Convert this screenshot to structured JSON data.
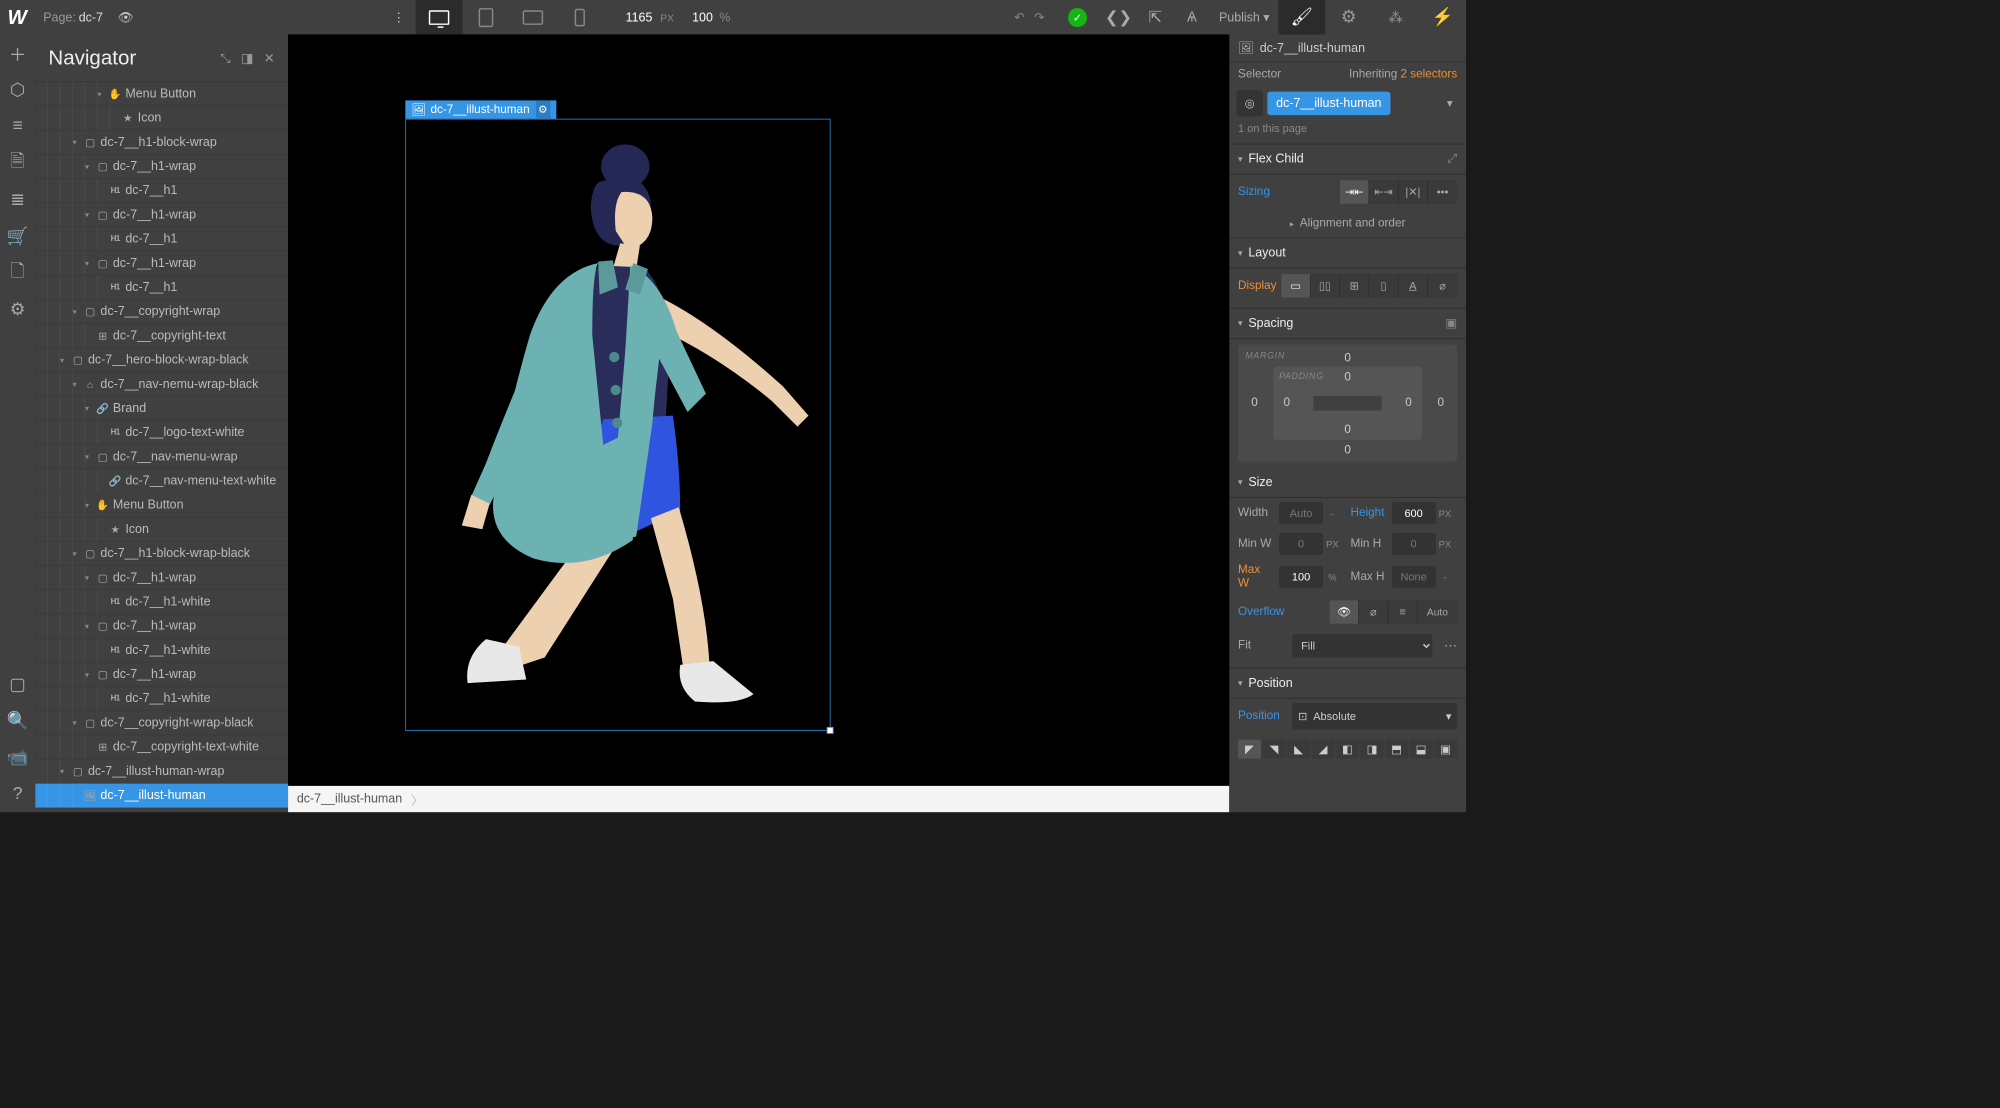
{
  "topbar": {
    "page_label": "Page:",
    "page_name": "dc-7",
    "canvas_width": "1165",
    "canvas_unit": "PX",
    "zoom": "100",
    "zoom_unit": "%",
    "publish": "Publish"
  },
  "navigator": {
    "title": "Navigator",
    "items": [
      {
        "indent": 5,
        "caret": "▾",
        "icon": "✋",
        "label": "Menu Button"
      },
      {
        "indent": 6,
        "caret": "",
        "icon": "★",
        "label": "Icon"
      },
      {
        "indent": 3,
        "caret": "▾",
        "icon": "▢",
        "label": "dc-7__h1-block-wrap"
      },
      {
        "indent": 4,
        "caret": "▾",
        "icon": "▢",
        "label": "dc-7__h1-wrap"
      },
      {
        "indent": 5,
        "caret": "",
        "icon": "H1",
        "label": "dc-7__h1"
      },
      {
        "indent": 4,
        "caret": "▾",
        "icon": "▢",
        "label": "dc-7__h1-wrap"
      },
      {
        "indent": 5,
        "caret": "",
        "icon": "H1",
        "label": "dc-7__h1"
      },
      {
        "indent": 4,
        "caret": "▾",
        "icon": "▢",
        "label": "dc-7__h1-wrap"
      },
      {
        "indent": 5,
        "caret": "",
        "icon": "H1",
        "label": "dc-7__h1"
      },
      {
        "indent": 3,
        "caret": "▾",
        "icon": "▢",
        "label": "dc-7__copyright-wrap"
      },
      {
        "indent": 4,
        "caret": "",
        "icon": "⊞",
        "label": "dc-7__copyright-text"
      },
      {
        "indent": 2,
        "caret": "▾",
        "icon": "▢",
        "label": "dc-7__hero-block-wrap-black"
      },
      {
        "indent": 3,
        "caret": "▾",
        "icon": "⌂",
        "label": "dc-7__nav-nemu-wrap-black"
      },
      {
        "indent": 4,
        "caret": "▾",
        "icon": "🔗",
        "label": "Brand"
      },
      {
        "indent": 5,
        "caret": "",
        "icon": "H1",
        "label": "dc-7__logo-text-white"
      },
      {
        "indent": 4,
        "caret": "▾",
        "icon": "▢",
        "label": "dc-7__nav-menu-wrap"
      },
      {
        "indent": 5,
        "caret": "",
        "icon": "🔗",
        "label": "dc-7__nav-menu-text-white"
      },
      {
        "indent": 4,
        "caret": "▾",
        "icon": "✋",
        "label": "Menu Button"
      },
      {
        "indent": 5,
        "caret": "",
        "icon": "★",
        "label": "Icon"
      },
      {
        "indent": 3,
        "caret": "▾",
        "icon": "▢",
        "label": "dc-7__h1-block-wrap-black"
      },
      {
        "indent": 4,
        "caret": "▾",
        "icon": "▢",
        "label": "dc-7__h1-wrap"
      },
      {
        "indent": 5,
        "caret": "",
        "icon": "H1",
        "label": "dc-7__h1-white"
      },
      {
        "indent": 4,
        "caret": "▾",
        "icon": "▢",
        "label": "dc-7__h1-wrap"
      },
      {
        "indent": 5,
        "caret": "",
        "icon": "H1",
        "label": "dc-7__h1-white"
      },
      {
        "indent": 4,
        "caret": "▾",
        "icon": "▢",
        "label": "dc-7__h1-wrap"
      },
      {
        "indent": 5,
        "caret": "",
        "icon": "H1",
        "label": "dc-7__h1-white"
      },
      {
        "indent": 3,
        "caret": "▾",
        "icon": "▢",
        "label": "dc-7__copyright-wrap-black"
      },
      {
        "indent": 4,
        "caret": "",
        "icon": "⊞",
        "label": "dc-7__copyright-text-white"
      },
      {
        "indent": 2,
        "caret": "▾",
        "icon": "▢",
        "label": "dc-7__illust-human-wrap"
      },
      {
        "indent": 3,
        "caret": "",
        "icon": "🖼",
        "label": "dc-7__illust-human",
        "selected": true
      }
    ]
  },
  "canvas": {
    "selected_label": "dc-7__illust-human"
  },
  "breadcrumb": {
    "item": "dc-7__illust-human"
  },
  "rpanel": {
    "selected_element": "dc-7__illust-human",
    "selector_label": "Selector",
    "inheriting_label": "Inheriting",
    "inheriting_count": "2 selectors",
    "selector_chip": "dc-7__illust-human",
    "count_hint": "1 on this page",
    "sections": {
      "flex_child": "Flex Child",
      "layout": "Layout",
      "spacing": "Spacing",
      "size": "Size",
      "position": "Position"
    },
    "flex": {
      "sizing_label": "Sizing",
      "align_order": "Alignment and order"
    },
    "layout": {
      "display_label": "Display"
    },
    "spacing": {
      "margin_label": "MARGIN",
      "padding_label": "PADDING",
      "m_top": "0",
      "m_right": "0",
      "m_bottom": "0",
      "m_left": "0",
      "p_top": "0",
      "p_right": "0",
      "p_bottom": "0",
      "p_left": "0"
    },
    "size": {
      "width_label": "Width",
      "width_value": "Auto",
      "width_unit": "-",
      "height_label": "Height",
      "height_value": "600",
      "height_unit": "PX",
      "minw_label": "Min W",
      "minw_value": "0",
      "minw_unit": "PX",
      "minh_label": "Min H",
      "minh_value": "0",
      "minh_unit": "PX",
      "maxw_label": "Max W",
      "maxw_value": "100",
      "maxw_unit": "%",
      "maxh_label": "Max H",
      "maxh_value": "None",
      "maxh_unit": "-",
      "overflow_label": "Overflow",
      "overflow_auto": "Auto",
      "fit_label": "Fit",
      "fit_value": "Fill"
    },
    "position": {
      "position_label": "Position",
      "position_value": "Absolute"
    }
  }
}
